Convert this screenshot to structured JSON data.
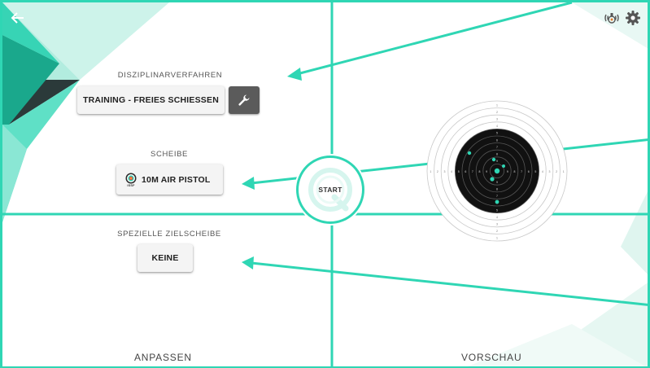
{
  "header": {
    "back_icon": "arrow-left-icon",
    "right_icons": [
      "wireless-sensor-icon",
      "gear-icon"
    ]
  },
  "left_panel": {
    "discipline": {
      "label": "DISZIPLINARVERFAHREN",
      "button_label": "TRAINING - FREIES SCHIESSEN",
      "settings_icon": "wrench-icon"
    },
    "target": {
      "label": "SCHEIBE",
      "button_label": "10M AIR PISTOL",
      "icon": "issf-target-icon",
      "icon_caption": "ISSF"
    },
    "special_target": {
      "label": "SPEZIELLE ZIELSCHEIBE",
      "button_label": "KEINE"
    },
    "footer_label": "ANPASSEN"
  },
  "start_button": {
    "label": "START"
  },
  "right_panel": {
    "footer_label": "VORSCHAU",
    "target_preview": {
      "ring_numbers": [
        "1",
        "2",
        "3",
        "4",
        "5",
        "6",
        "7",
        "8",
        "9"
      ]
    }
  },
  "colors": {
    "accent": "#2fd6b4",
    "accent_dark": "#1aa88c",
    "dark_triangle": "#2b3a3a",
    "button_bg": "#f4f4f4",
    "icon_button_bg": "#5b5b5b"
  }
}
